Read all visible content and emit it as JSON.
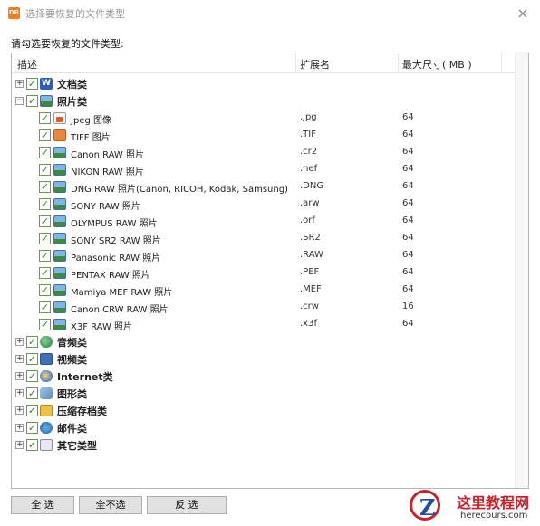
{
  "window": {
    "app_icon_text": "DR",
    "title": "选择要恢复的文件类型",
    "close_label": "×"
  },
  "prompt": "请勾选要恢复的文件类型:",
  "columns": {
    "desc": "描述",
    "ext": "扩展名",
    "size": "最大尺寸( MB )"
  },
  "groups": {
    "document": {
      "expander": "+",
      "label": "文档类",
      "icon": "word-icon",
      "icon_text": "W"
    },
    "photo": {
      "expander": "−",
      "label": "照片类",
      "icon": "photo-icon",
      "items": [
        {
          "label": "Jpeg 图像",
          "ext": ".jpg",
          "size": "64",
          "icon": "jpeg-icon"
        },
        {
          "label": "TIFF 图片",
          "ext": ".TIF",
          "size": "64",
          "icon": "tiff-icon"
        },
        {
          "label": "Canon RAW 照片",
          "ext": ".cr2",
          "size": "64",
          "icon": "photo-icon"
        },
        {
          "label": "NIKON RAW 照片",
          "ext": ".nef",
          "size": "64",
          "icon": "photo-icon"
        },
        {
          "label": "DNG RAW 照片(Canon, RICOH, Kodak, Samsung)",
          "ext": ".DNG",
          "size": "64",
          "icon": "photo-icon"
        },
        {
          "label": "SONY RAW 照片",
          "ext": ".arw",
          "size": "64",
          "icon": "photo-icon"
        },
        {
          "label": "OLYMPUS RAW 照片",
          "ext": ".orf",
          "size": "64",
          "icon": "photo-icon"
        },
        {
          "label": "SONY SR2 RAW 照片",
          "ext": ".SR2",
          "size": "64",
          "icon": "photo-icon"
        },
        {
          "label": "Panasonic RAW 照片",
          "ext": ".RAW",
          "size": "64",
          "icon": "photo-icon"
        },
        {
          "label": "PENTAX RAW 照片",
          "ext": ".PEF",
          "size": "64",
          "icon": "photo-icon"
        },
        {
          "label": "Mamiya MEF RAW 照片",
          "ext": ".MEF",
          "size": "64",
          "icon": "photo-icon"
        },
        {
          "label": "Canon CRW RAW 照片",
          "ext": ".crw",
          "size": "16",
          "icon": "photo-icon"
        },
        {
          "label": "X3F RAW 照片",
          "ext": ".x3f",
          "size": "64",
          "icon": "photo-icon"
        }
      ]
    },
    "audio": {
      "expander": "+",
      "label": "音频类",
      "icon": "audio-icon"
    },
    "video": {
      "expander": "+",
      "label": "视频类",
      "icon": "video-icon"
    },
    "internet": {
      "expander": "+",
      "label": "Internet类",
      "icon": "internet-icon"
    },
    "graphic": {
      "expander": "+",
      "label": "图形类",
      "icon": "graphic-icon"
    },
    "archive": {
      "expander": "+",
      "label": "压缩存档类",
      "icon": "archive-icon"
    },
    "mail": {
      "expander": "+",
      "label": "邮件类",
      "icon": "mail-icon"
    },
    "other": {
      "expander": "+",
      "label": "其它类型",
      "icon": "other-icon"
    }
  },
  "checkbox_mark": "✓",
  "buttons": {
    "select_all": "全 选",
    "select_none": "全不选",
    "invert": "反 选"
  },
  "watermark": {
    "logo_letter": "Z",
    "title": "这里教程网",
    "url": "herecours.com"
  }
}
